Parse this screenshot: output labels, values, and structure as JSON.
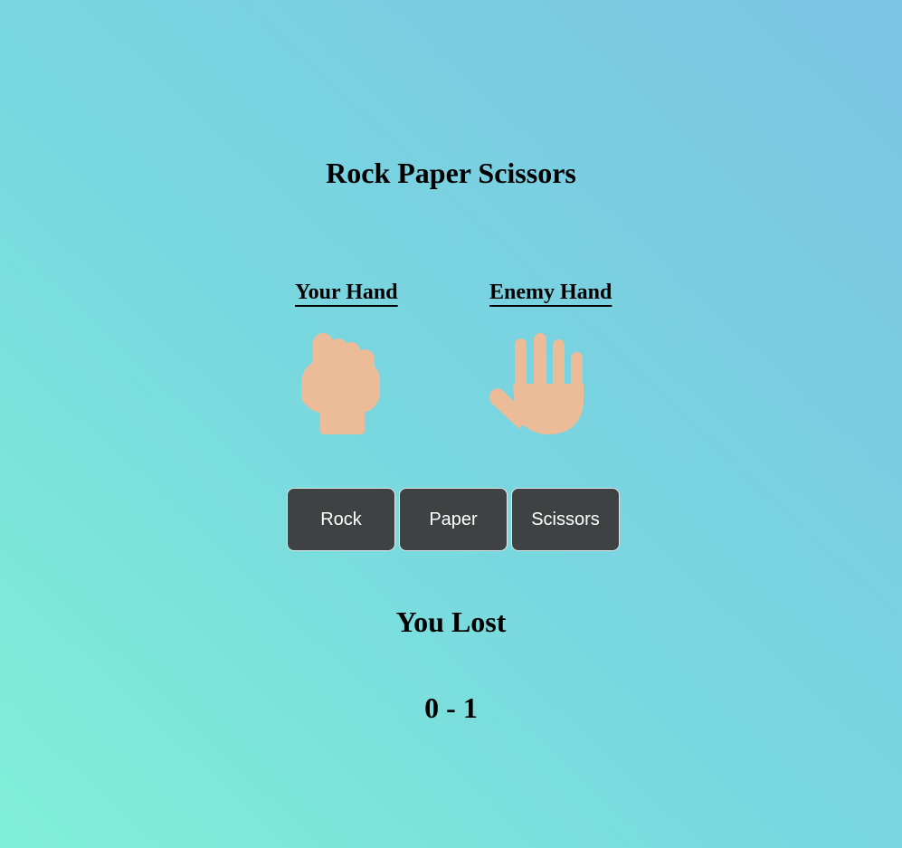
{
  "game": {
    "title": "Rock Paper Scissors",
    "your_hand_label": "Your Hand",
    "enemy_hand_label": "Enemy Hand",
    "your_hand": "rock",
    "enemy_hand": "paper",
    "your_hand_icon": "raised-fist-icon",
    "enemy_hand_icon": "raised-hand-icon",
    "skin_color": "#ecbb98"
  },
  "buttons": {
    "rock": "Rock",
    "paper": "Paper",
    "scissors": "Scissors"
  },
  "result": {
    "message": "You Lost",
    "score": "0 - 1"
  }
}
